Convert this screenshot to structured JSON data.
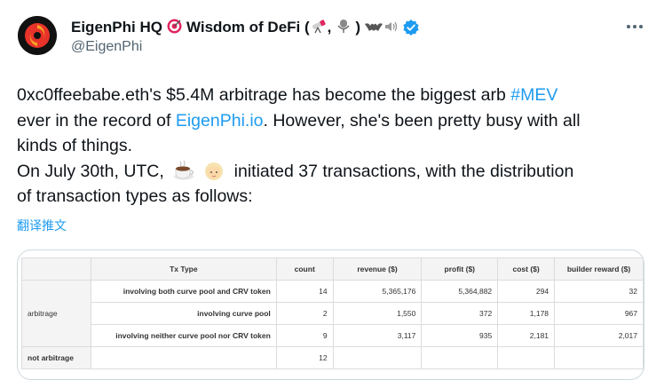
{
  "author": {
    "display_name": "EigenPhi HQ",
    "title_suffix": "Wisdom of DeFi (",
    "title_mid": ",",
    "title_end": ")",
    "handle": "@EigenPhi"
  },
  "tweet": {
    "line1_pre": "0xc0ffeebabe.eth's $5.4M arbitrage has become the biggest arb ",
    "hashtag": "#MEV",
    "line2_pre": "ever in the record of ",
    "link": "EigenPhi.io",
    "line2_post": ". However, she's been pretty busy with all",
    "line3": "kinds of things.",
    "line4_pre": "On July 30th, UTC,",
    "line4_post": "initiated 37 transactions, with the distribution",
    "line5": "of transaction types as follows:"
  },
  "translate_label": "翻译推文",
  "table": {
    "headers": [
      "Tx Type",
      "count",
      "revenue ($)",
      "profit ($)",
      "cost ($)",
      "builder reward ($)"
    ],
    "arbitrage_label": "arbitrage",
    "not_arbitrage_label": "not arbitrage",
    "rows": [
      {
        "type": "involving both curve pool and CRV token",
        "count": "14",
        "revenue": "5,365,176",
        "profit": "5,364,882",
        "cost": "294",
        "builder": "32"
      },
      {
        "type": "involving curve pool",
        "count": "2",
        "revenue": "1,550",
        "profit": "372",
        "cost": "1,178",
        "builder": "967"
      },
      {
        "type": "involving neither curve pool nor CRV token",
        "count": "9",
        "revenue": "3,117",
        "profit": "935",
        "cost": "2,181",
        "builder": "2,017"
      }
    ],
    "not_arbitrage_count": "12"
  },
  "colors": {
    "link": "#1d9bf0",
    "verified": "#1d9bf0",
    "text": "#0f1419",
    "muted": "#536471"
  },
  "icons": {
    "avatar": "eigenphi-logo",
    "verified": "verified-badge-icon",
    "more": "more-options-icon"
  }
}
